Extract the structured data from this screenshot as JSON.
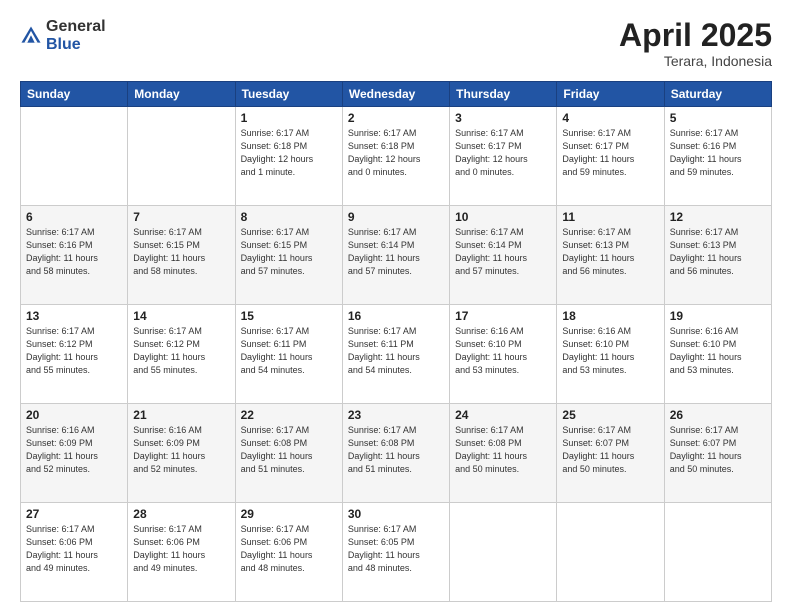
{
  "header": {
    "logo": {
      "general": "General",
      "blue": "Blue"
    },
    "title": "April 2025",
    "location": "Terara, Indonesia"
  },
  "calendar": {
    "days_of_week": [
      "Sunday",
      "Monday",
      "Tuesday",
      "Wednesday",
      "Thursday",
      "Friday",
      "Saturday"
    ],
    "weeks": [
      [
        {
          "day": "",
          "detail": ""
        },
        {
          "day": "",
          "detail": ""
        },
        {
          "day": "1",
          "detail": "Sunrise: 6:17 AM\nSunset: 6:18 PM\nDaylight: 12 hours\nand 1 minute."
        },
        {
          "day": "2",
          "detail": "Sunrise: 6:17 AM\nSunset: 6:18 PM\nDaylight: 12 hours\nand 0 minutes."
        },
        {
          "day": "3",
          "detail": "Sunrise: 6:17 AM\nSunset: 6:17 PM\nDaylight: 12 hours\nand 0 minutes."
        },
        {
          "day": "4",
          "detail": "Sunrise: 6:17 AM\nSunset: 6:17 PM\nDaylight: 11 hours\nand 59 minutes."
        },
        {
          "day": "5",
          "detail": "Sunrise: 6:17 AM\nSunset: 6:16 PM\nDaylight: 11 hours\nand 59 minutes."
        }
      ],
      [
        {
          "day": "6",
          "detail": "Sunrise: 6:17 AM\nSunset: 6:16 PM\nDaylight: 11 hours\nand 58 minutes."
        },
        {
          "day": "7",
          "detail": "Sunrise: 6:17 AM\nSunset: 6:15 PM\nDaylight: 11 hours\nand 58 minutes."
        },
        {
          "day": "8",
          "detail": "Sunrise: 6:17 AM\nSunset: 6:15 PM\nDaylight: 11 hours\nand 57 minutes."
        },
        {
          "day": "9",
          "detail": "Sunrise: 6:17 AM\nSunset: 6:14 PM\nDaylight: 11 hours\nand 57 minutes."
        },
        {
          "day": "10",
          "detail": "Sunrise: 6:17 AM\nSunset: 6:14 PM\nDaylight: 11 hours\nand 57 minutes."
        },
        {
          "day": "11",
          "detail": "Sunrise: 6:17 AM\nSunset: 6:13 PM\nDaylight: 11 hours\nand 56 minutes."
        },
        {
          "day": "12",
          "detail": "Sunrise: 6:17 AM\nSunset: 6:13 PM\nDaylight: 11 hours\nand 56 minutes."
        }
      ],
      [
        {
          "day": "13",
          "detail": "Sunrise: 6:17 AM\nSunset: 6:12 PM\nDaylight: 11 hours\nand 55 minutes."
        },
        {
          "day": "14",
          "detail": "Sunrise: 6:17 AM\nSunset: 6:12 PM\nDaylight: 11 hours\nand 55 minutes."
        },
        {
          "day": "15",
          "detail": "Sunrise: 6:17 AM\nSunset: 6:11 PM\nDaylight: 11 hours\nand 54 minutes."
        },
        {
          "day": "16",
          "detail": "Sunrise: 6:17 AM\nSunset: 6:11 PM\nDaylight: 11 hours\nand 54 minutes."
        },
        {
          "day": "17",
          "detail": "Sunrise: 6:16 AM\nSunset: 6:10 PM\nDaylight: 11 hours\nand 53 minutes."
        },
        {
          "day": "18",
          "detail": "Sunrise: 6:16 AM\nSunset: 6:10 PM\nDaylight: 11 hours\nand 53 minutes."
        },
        {
          "day": "19",
          "detail": "Sunrise: 6:16 AM\nSunset: 6:10 PM\nDaylight: 11 hours\nand 53 minutes."
        }
      ],
      [
        {
          "day": "20",
          "detail": "Sunrise: 6:16 AM\nSunset: 6:09 PM\nDaylight: 11 hours\nand 52 minutes."
        },
        {
          "day": "21",
          "detail": "Sunrise: 6:16 AM\nSunset: 6:09 PM\nDaylight: 11 hours\nand 52 minutes."
        },
        {
          "day": "22",
          "detail": "Sunrise: 6:17 AM\nSunset: 6:08 PM\nDaylight: 11 hours\nand 51 minutes."
        },
        {
          "day": "23",
          "detail": "Sunrise: 6:17 AM\nSunset: 6:08 PM\nDaylight: 11 hours\nand 51 minutes."
        },
        {
          "day": "24",
          "detail": "Sunrise: 6:17 AM\nSunset: 6:08 PM\nDaylight: 11 hours\nand 50 minutes."
        },
        {
          "day": "25",
          "detail": "Sunrise: 6:17 AM\nSunset: 6:07 PM\nDaylight: 11 hours\nand 50 minutes."
        },
        {
          "day": "26",
          "detail": "Sunrise: 6:17 AM\nSunset: 6:07 PM\nDaylight: 11 hours\nand 50 minutes."
        }
      ],
      [
        {
          "day": "27",
          "detail": "Sunrise: 6:17 AM\nSunset: 6:06 PM\nDaylight: 11 hours\nand 49 minutes."
        },
        {
          "day": "28",
          "detail": "Sunrise: 6:17 AM\nSunset: 6:06 PM\nDaylight: 11 hours\nand 49 minutes."
        },
        {
          "day": "29",
          "detail": "Sunrise: 6:17 AM\nSunset: 6:06 PM\nDaylight: 11 hours\nand 48 minutes."
        },
        {
          "day": "30",
          "detail": "Sunrise: 6:17 AM\nSunset: 6:05 PM\nDaylight: 11 hours\nand 48 minutes."
        },
        {
          "day": "",
          "detail": ""
        },
        {
          "day": "",
          "detail": ""
        },
        {
          "day": "",
          "detail": ""
        }
      ]
    ]
  }
}
